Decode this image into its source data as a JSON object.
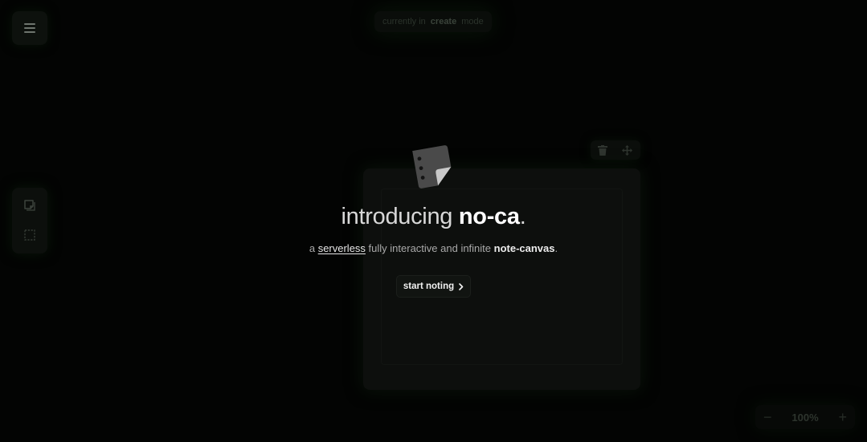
{
  "canvas": {
    "mode_indicator": {
      "prefix": "currently in",
      "mode": "create",
      "suffix": "mode"
    },
    "menu_icon": "hamburger-menu-icon",
    "tools": [
      {
        "name": "note-tool",
        "icon": "sticky-note-icon"
      },
      {
        "name": "selection-tool",
        "icon": "dashed-square-icon"
      }
    ],
    "note_toolbar": {
      "delete_icon": "trash-icon",
      "move_icon": "move-arrows-icon"
    },
    "zoom": {
      "decrease": "−",
      "level": "100%",
      "increase": "+"
    }
  },
  "intro": {
    "logo_icon": "sticky-note-logo-icon",
    "heading_prefix": "introducing ",
    "product_name": "no-ca",
    "heading_suffix": ".",
    "subtitle": {
      "part1": "a ",
      "link": "serverless",
      "part2": " fully interactive and infinite ",
      "strong": "note-canvas",
      "part3": "."
    },
    "cta_label": "start noting",
    "cta_icon": "chevron-right-icon"
  },
  "colors": {
    "background": "#030403",
    "heading": "#d8d8d8",
    "product": "#ffffff",
    "subtitle": "#a9a9a9",
    "button_bg": "#111411"
  }
}
